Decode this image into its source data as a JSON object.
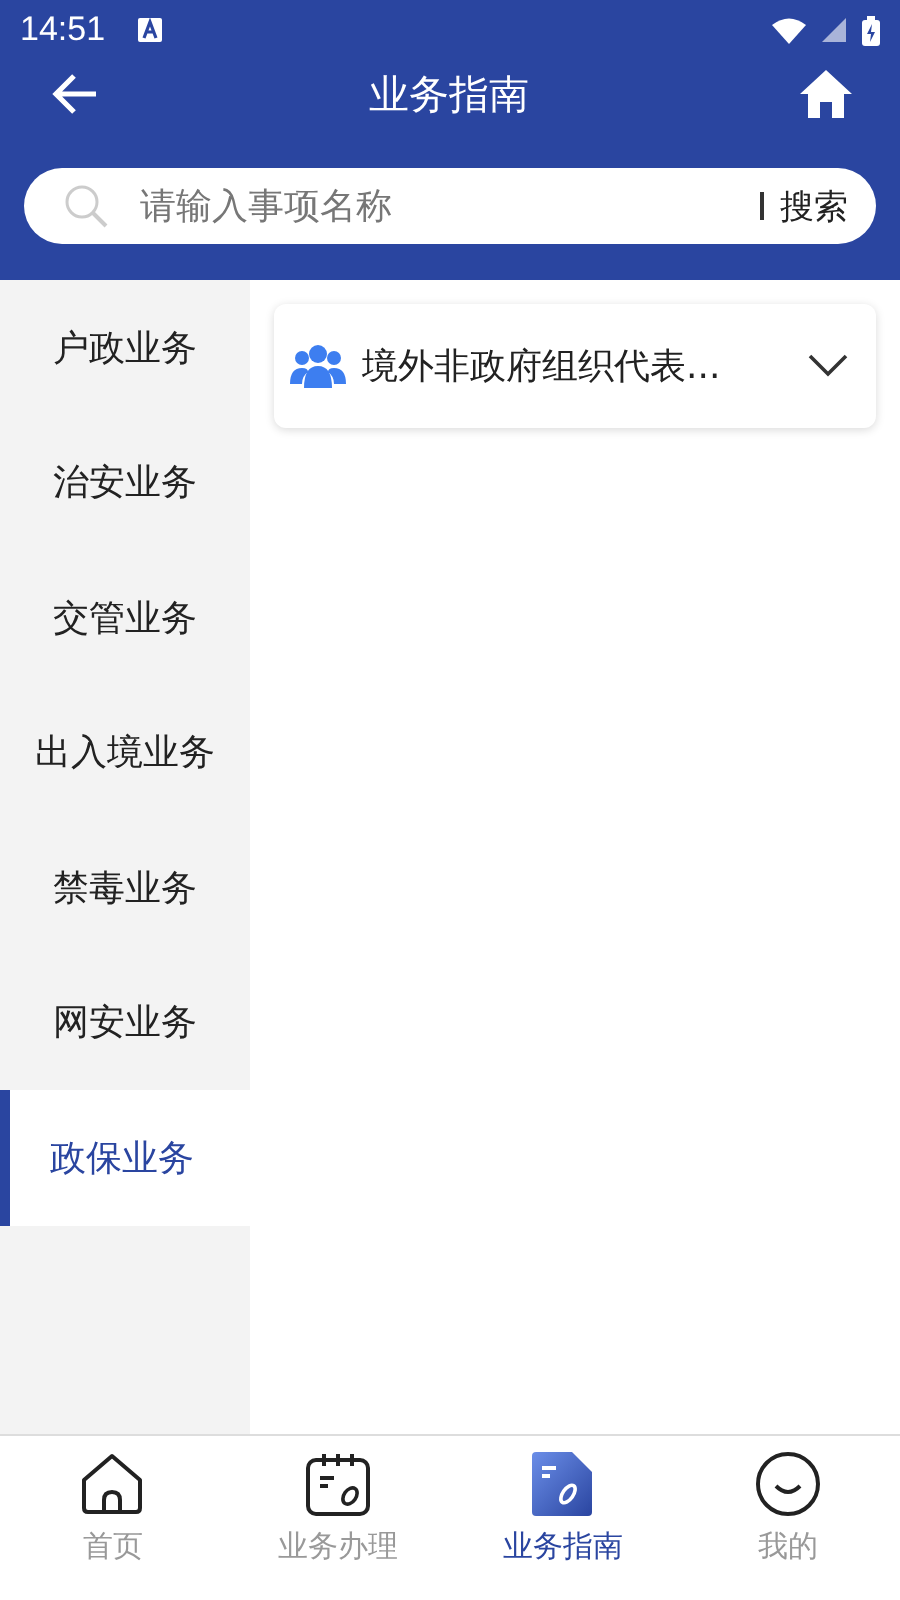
{
  "status_bar": {
    "time": "14:51"
  },
  "header": {
    "title": "业务指南"
  },
  "search": {
    "placeholder": "请输入事项名称",
    "button": "搜索"
  },
  "sidebar": {
    "items": [
      {
        "label": "户政业务",
        "selected": false
      },
      {
        "label": "治安业务",
        "selected": false
      },
      {
        "label": "交管业务",
        "selected": false
      },
      {
        "label": "出入境业务",
        "selected": false
      },
      {
        "label": "禁毒业务",
        "selected": false
      },
      {
        "label": "网安业务",
        "selected": false
      },
      {
        "label": "政保业务",
        "selected": true
      }
    ]
  },
  "content": {
    "items": [
      {
        "label": "境外非政府组织代表...",
        "expanded": false
      }
    ]
  },
  "tab_bar": {
    "tabs": [
      {
        "kind": "home",
        "label": "首页",
        "selected": false
      },
      {
        "kind": "calendar",
        "label": "业务办理",
        "selected": false
      },
      {
        "kind": "doc",
        "label": "业务指南",
        "selected": true
      },
      {
        "kind": "smile",
        "label": "我的",
        "selected": false
      }
    ]
  }
}
